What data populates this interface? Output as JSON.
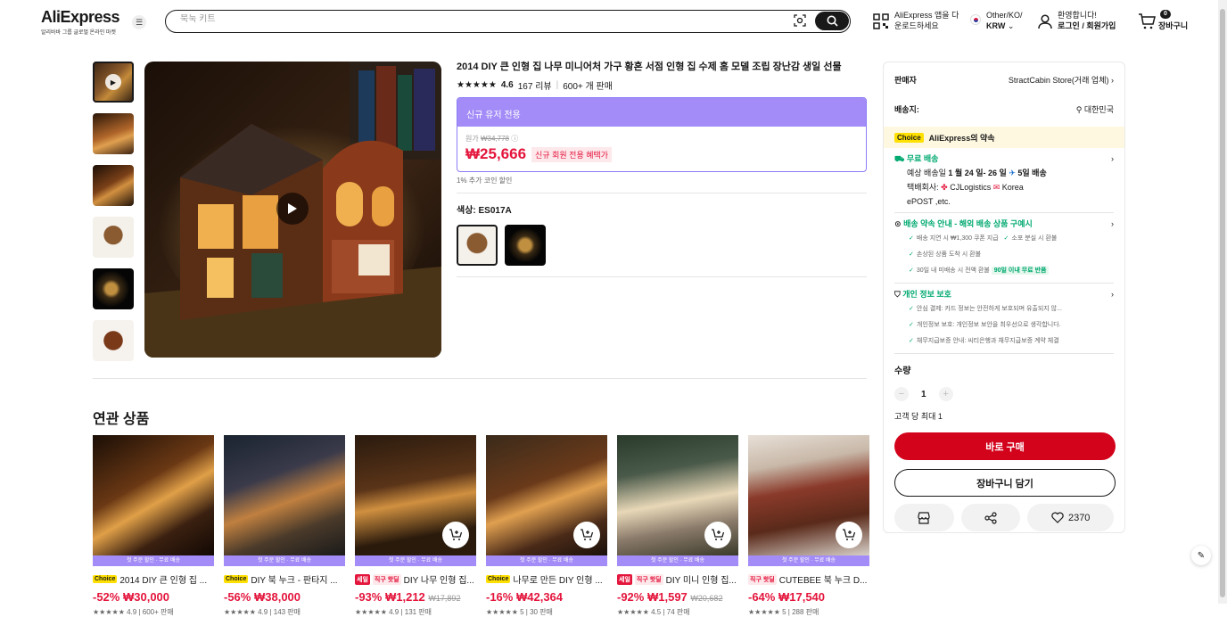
{
  "header": {
    "logo": "AliExpress",
    "logo_sub": "알리바바 그룹 글로벌 온라인 마켓",
    "search_placeholder": "북눅 키트",
    "app_line1": "AliExpress 앱을 다",
    "app_line2": "운로드하세요",
    "locale_line1": "Other/KO/",
    "locale_line2": "KRW",
    "account_line1": "환영합니다!",
    "account_line2": "로그인 / 회원가입",
    "cart_count": "0",
    "cart_label": "장바구니"
  },
  "product": {
    "title": "2014 DIY 큰 인형 집 나무 미니어처 가구 황혼 서점 인형 집 수제 홈 모델 조립 장난감 생일 선물",
    "rating": "4.6",
    "reviews": "167 리뷰",
    "sold": "600+ 개 판매",
    "promo_header": "신규 유저 전용",
    "orig_label": "원가",
    "orig_price": "₩34,778",
    "price": "₩25,666",
    "price_tag": "신규 회원 전용 혜택가",
    "coin": "1% 추가 코인 할인",
    "color_label": "색상: ES017A"
  },
  "sidebar": {
    "seller_label": "판매자",
    "seller_name": "StractCabin Store(거래 업체)",
    "ship_to_label": "배송지:",
    "ship_to": "대한민국",
    "choice_tag": "Choice",
    "choice_title": "AliExpress의 약속",
    "free_ship": "무료 배송",
    "eta_prefix": "예상 배송일",
    "eta_dates": "1 월 24 일- 26 일",
    "eta_days": "5일 배송",
    "carrier_label": "택배회사:",
    "carrier_1": "CJLogistics",
    "carrier_2": "Korea",
    "carrier_3": "ePOST ,etc.",
    "guarantee_title": "배송 약속 안내 - 해외 배송 상품 구예시",
    "g1": "배송 지연 시 ₩1,300 쿠폰 지급",
    "g2": "소포 분실 시 환불",
    "g3": "손상된 상품 도착 시 환불",
    "g4": "30일 내 미배송 시 전액 환불",
    "g4_tag": "90일 이내 무료 반품",
    "privacy_title": "개인 정보 보호",
    "p1": "안심 결제: 카드 정보는 안전하게 보호되며 유출되지 않...",
    "p2": "개인정보 보호: 개인정보 보안을 최우선으로 생각합니다.",
    "p3": "채무지급보증 안내: 씨티은행과 채무지급보증 계약 체결",
    "qty_label": "수량",
    "qty_value": "1",
    "qty_limit": "고객 당 최대 1",
    "buy_now": "바로 구매",
    "add_cart": "장바구니 담기",
    "wish_count": "2370"
  },
  "related": {
    "title": "연관 상품",
    "band": "첫 주문 할인 · 무료 배송",
    "items": [
      {
        "tag": "Choice",
        "tag_type": "choice",
        "tag2": "",
        "title": "2014 DIY 큰 인형 집 ...",
        "discount": "-52%",
        "price": "₩30,000",
        "orig": "",
        "meta": "4.9 | 600+ 판매"
      },
      {
        "tag": "Choice",
        "tag_type": "choice",
        "tag2": "",
        "title": "DIY 북 누크 - 판타지 ...",
        "discount": "-56%",
        "price": "₩38,000",
        "orig": "",
        "meta": "4.9 | 143 판매"
      },
      {
        "tag": "세일",
        "tag_type": "sale",
        "tag2": "직구 핫딜",
        "title": "DIY 나무 인형 집...",
        "discount": "-93%",
        "price": "₩1,212",
        "orig": "₩17,892",
        "meta": "4.9 | 131 판매"
      },
      {
        "tag": "Choice",
        "tag_type": "choice",
        "tag2": "",
        "title": "나무로 만든 DIY 인형 ...",
        "discount": "-16%",
        "price": "₩42,364",
        "orig": "",
        "meta": "5 | 30 판매"
      },
      {
        "tag": "세일",
        "tag_type": "sale",
        "tag2": "직구 핫딜",
        "title": "DIY 미니 인형 집...",
        "discount": "-92%",
        "price": "₩1,597",
        "orig": "₩20,682",
        "meta": "4.5 | 74 판매"
      },
      {
        "tag": "직구 핫딜",
        "tag_type": "fast",
        "tag2": "",
        "title": "CUTEBEE 북 누크 D...",
        "discount": "-64%",
        "price": "₩17,540",
        "orig": "",
        "meta": "5 | 288 판매"
      }
    ]
  },
  "colors": {
    "accent": "#e4153c",
    "purple": "#a38cf7",
    "green": "#01a971",
    "buy": "#d3031c"
  }
}
